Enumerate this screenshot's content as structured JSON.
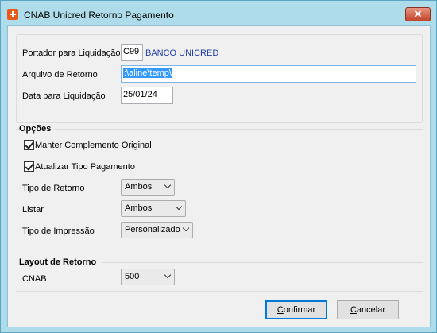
{
  "window": {
    "title": "CNAB Unicred Retorno Pagamento",
    "close_glyph": "✕"
  },
  "fields": {
    "portador_label": "Portador para Liquidação",
    "portador_code": "C99",
    "portador_name": "BANCO UNICRED",
    "arquivo_label": "Arquivo de Retorno",
    "arquivo_value": ":\\aline\\temp\\",
    "data_label": "Data para Liquidação",
    "data_value": "25/01/24"
  },
  "opcoes": {
    "title": "Opções",
    "manter": {
      "label": "Manter Complemento Original",
      "checked": true
    },
    "atualizar": {
      "label": "Atualizar Tipo Pagamento",
      "checked": true
    },
    "tipo_retorno": {
      "label": "Tipo de Retorno",
      "value": "Ambos"
    },
    "listar": {
      "label": "Listar",
      "value": "Ambos"
    },
    "tipo_impressao": {
      "label": "Tipo de Impressão",
      "value": "Personalizado"
    }
  },
  "layout": {
    "title": "Layout de Retorno",
    "cnab_label": "CNAB",
    "cnab_value": "500"
  },
  "buttons": {
    "confirmar_first": "C",
    "confirmar_rest": "onfirmar",
    "cancelar_first": "C",
    "cancelar_rest": "ancelar"
  },
  "colors": {
    "titlebar": "#aedcea",
    "selection": "#3399ff",
    "link": "#1f3ea6"
  },
  "icons": {
    "app": "app-icon",
    "close": "close-icon",
    "dropdown": "chevron-down-icon",
    "check": "checkmark-icon"
  }
}
